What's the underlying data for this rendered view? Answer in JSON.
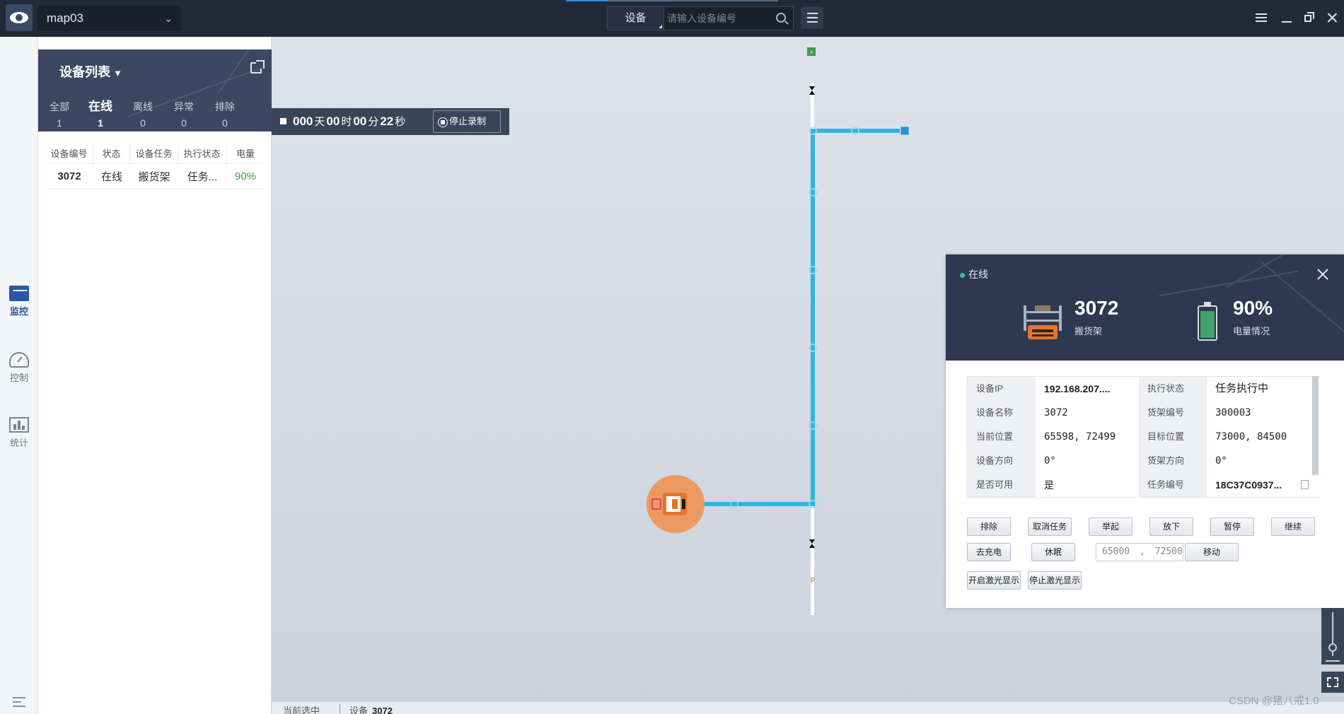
{
  "topbar": {
    "map_name": "map03",
    "search_type": "设备",
    "search_placeholder": "请输入设备编号"
  },
  "rail": [
    {
      "label": "监控",
      "icon": "monitor-icon",
      "active": true
    },
    {
      "label": "控制",
      "icon": "gauge-icon",
      "active": false
    },
    {
      "label": "统计",
      "icon": "bar-chart-icon",
      "active": false
    }
  ],
  "device_list": {
    "title": "设备列表",
    "tabs": [
      {
        "label": "全部",
        "count": "1"
      },
      {
        "label": "在线",
        "count": "1"
      },
      {
        "label": "离线",
        "count": "0"
      },
      {
        "label": "异常",
        "count": "0"
      },
      {
        "label": "排除",
        "count": "0"
      }
    ],
    "columns": [
      "设备编号",
      "状态",
      "设备任务",
      "执行状态",
      "电量"
    ],
    "rows": [
      {
        "id": "3072",
        "status": "在线",
        "task": "搬货架",
        "exec": "任务...",
        "battery": "90%"
      }
    ]
  },
  "recording": {
    "days": "000",
    "day_unit": "天",
    "hours": "00",
    "hour_unit": "时",
    "minutes": "00",
    "minute_unit": "分",
    "seconds": "22",
    "second_unit": "秒",
    "stop_label": "停止录制"
  },
  "map": {
    "route_color": "#2db7e0",
    "robot_color": "#e8742c",
    "top_marker": "⚡",
    "bottom_marker": "P"
  },
  "detail": {
    "status": "在线",
    "device_number": "3072",
    "device_type": "搬货架",
    "battery_value": "90%",
    "battery_level": 0.9,
    "battery_label": "电量情况",
    "info": [
      {
        "k1": "设备IP",
        "v1": "192.168.207....",
        "k2": "执行状态",
        "v2": "任务执行中"
      },
      {
        "k1": "设备名称",
        "v1": "3072",
        "k2": "货架编号",
        "v2": "300003"
      },
      {
        "k1": "当前位置",
        "v1": "65598, 72499",
        "k2": "目标位置",
        "v2": "73000, 84500"
      },
      {
        "k1": "设备方向",
        "v1": "0°",
        "k2": "货架方向",
        "v2": "0°"
      },
      {
        "k1": "是否可用",
        "v1": "是",
        "k2": "任务编号",
        "v2": "18C37C0937..."
      }
    ],
    "buttons_row1": [
      "排除",
      "取消任务",
      "举起",
      "放下",
      "暂停",
      "继续"
    ],
    "buttons_row2": [
      "去充电",
      "休眠"
    ],
    "coord_x": "65000",
    "coord_sep": ",",
    "coord_y": "72500",
    "move_label": "移动",
    "buttons_row3": [
      "开启激光显示",
      "停止激光显示"
    ]
  },
  "statusbar": {
    "selected_label": "当前选中",
    "device_label": "设备",
    "device_value": "3072"
  },
  "watermark": "CSDN @猪八戒1.0"
}
